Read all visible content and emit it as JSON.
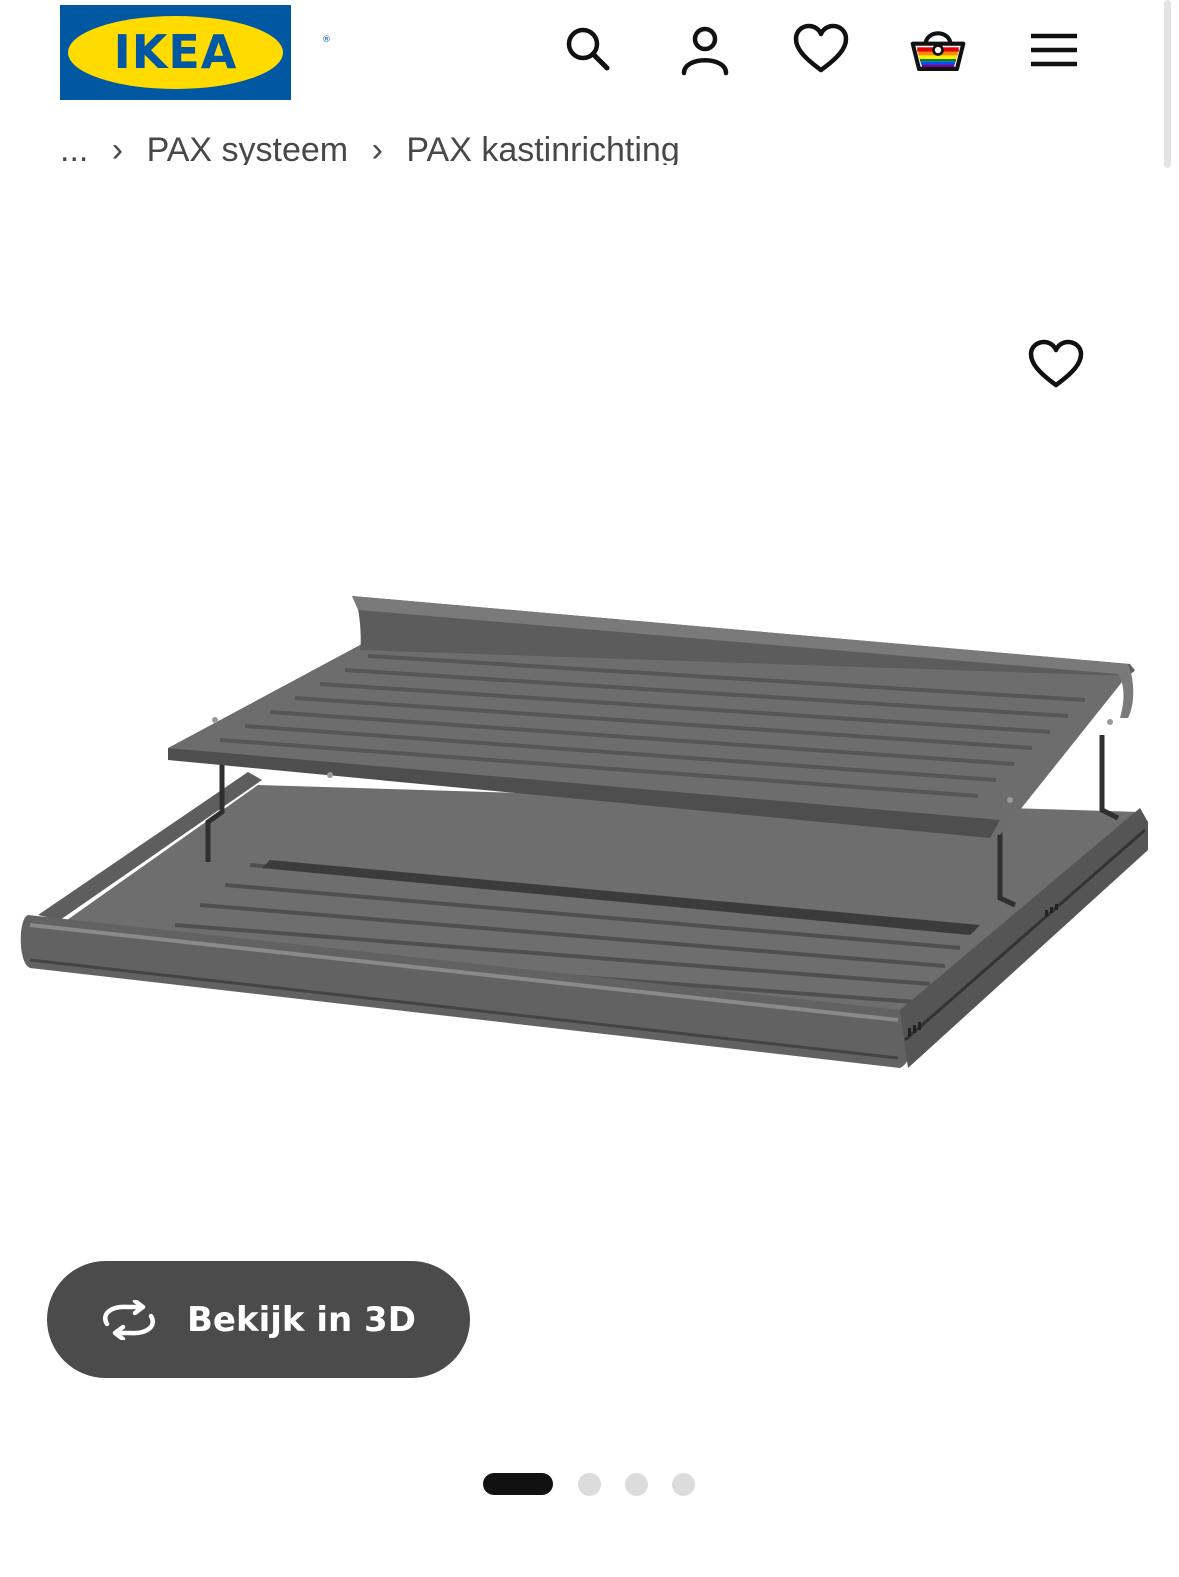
{
  "header": {
    "logo_text": "IKEA",
    "logo_registered": "®",
    "icons": [
      "search-icon",
      "account-icon",
      "favourites-icon",
      "basket-icon",
      "menu-icon"
    ]
  },
  "breadcrumb": {
    "items": [
      "...",
      "›",
      "PAX systeem",
      "›",
      "PAX kastinrichting"
    ]
  },
  "product": {
    "favourite_icon": "heart-icon",
    "view_3d_label": "Bekijk in 3D",
    "view_3d_icon": "rotate-3d-icon"
  },
  "carousel": {
    "total_slides": 4,
    "active_slide": 1
  },
  "colors": {
    "ikea_blue": "#0058a3",
    "ikea_yellow": "#ffdb00",
    "button_dark": "#4b4b4b",
    "product_grey": "#6b6b6b"
  }
}
